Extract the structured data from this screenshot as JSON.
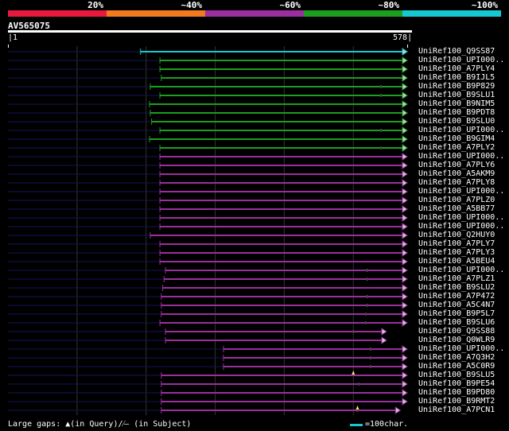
{
  "legend": {
    "segments": [
      {
        "label": "20%",
        "color": "#e8193c"
      },
      {
        "label": "~40%",
        "color": "#f07a1d"
      },
      {
        "label": "~60%",
        "color": "#9b2fa0"
      },
      {
        "label": "~80%",
        "color": "#1e9e1e"
      },
      {
        "label": "~100%",
        "color": "#17c7d2"
      }
    ]
  },
  "query": {
    "name": "AV565075",
    "start": "1",
    "end": "578",
    "length": 578
  },
  "hits": [
    {
      "name": "UniRef100_Q9SS87",
      "start": 192,
      "end": 578,
      "color": "#17c7d2",
      "gap": null
    },
    {
      "name": "UniRef100_UPI000..",
      "start": 220,
      "end": 578,
      "color": "#1e9e1e",
      "gap": null
    },
    {
      "name": "UniRef100_A7PLY4",
      "start": 220,
      "end": 578,
      "color": "#1e9e1e",
      "gap": null
    },
    {
      "name": "UniRef100_B9IJL5",
      "start": 222,
      "end": 578,
      "color": "#1e9e1e",
      "gap": null
    },
    {
      "name": "UniRef100_B9P829",
      "start": 206,
      "end": 578,
      "color": "#1e9e1e",
      "gap": 540
    },
    {
      "name": "UniRef100_B9SLU1",
      "start": 220,
      "end": 578,
      "color": "#1e9e1e",
      "gap": 540
    },
    {
      "name": "UniRef100_B9NIM5",
      "start": 205,
      "end": 578,
      "color": "#1e9e1e",
      "gap": null
    },
    {
      "name": "UniRef100_B9PDT8",
      "start": 206,
      "end": 578,
      "color": "#1e9e1e",
      "gap": null
    },
    {
      "name": "UniRef100_B9SLU0",
      "start": 208,
      "end": 578,
      "color": "#1e9e1e",
      "gap": null
    },
    {
      "name": "UniRef100_UPI000..",
      "start": 220,
      "end": 578,
      "color": "#1e9e1e",
      "gap": 540
    },
    {
      "name": "UniRef100_B9GIM4",
      "start": 205,
      "end": 578,
      "color": "#1e9e1e",
      "gap": null
    },
    {
      "name": "UniRef100_A7PLY2",
      "start": 220,
      "end": 578,
      "color": "#1e9e1e",
      "gap": 540
    },
    {
      "name": "UniRef100_UPI000..",
      "start": 220,
      "end": 578,
      "color": "#9b2fa0",
      "gap": null
    },
    {
      "name": "UniRef100_A7PLY6",
      "start": 220,
      "end": 578,
      "color": "#9b2fa0",
      "gap": null
    },
    {
      "name": "UniRef100_A5AKM9",
      "start": 220,
      "end": 578,
      "color": "#9b2fa0",
      "gap": null
    },
    {
      "name": "UniRef100_A7PLY8",
      "start": 220,
      "end": 578,
      "color": "#9b2fa0",
      "gap": null
    },
    {
      "name": "UniRef100_UPI000..",
      "start": 220,
      "end": 578,
      "color": "#9b2fa0",
      "gap": null
    },
    {
      "name": "UniRef100_A7PLZ0",
      "start": 220,
      "end": 578,
      "color": "#9b2fa0",
      "gap": null
    },
    {
      "name": "UniRef100_A5BB77",
      "start": 220,
      "end": 578,
      "color": "#9b2fa0",
      "gap": null
    },
    {
      "name": "UniRef100_UPI000..",
      "start": 220,
      "end": 578,
      "color": "#9b2fa0",
      "gap": null
    },
    {
      "name": "UniRef100_UPI000..",
      "start": 220,
      "end": 578,
      "color": "#9b2fa0",
      "gap": null
    },
    {
      "name": "UniRef100_Q2HUY0",
      "start": 206,
      "end": 578,
      "color": "#9b2fa0",
      "gap": null
    },
    {
      "name": "UniRef100_A7PLY7",
      "start": 220,
      "end": 578,
      "color": "#9b2fa0",
      "gap": null
    },
    {
      "name": "UniRef100_A7PLY3",
      "start": 220,
      "end": 578,
      "color": "#9b2fa0",
      "gap": null
    },
    {
      "name": "UniRef100_A5BEU4",
      "start": 220,
      "end": 578,
      "color": "#9b2fa0",
      "gap": null
    },
    {
      "name": "UniRef100_UPI000..",
      "start": 228,
      "end": 578,
      "color": "#9b2fa0",
      "gap": 520
    },
    {
      "name": "UniRef100_A7PLZ1",
      "start": 226,
      "end": 578,
      "color": "#9b2fa0",
      "gap": 520
    },
    {
      "name": "UniRef100_B9SLU2",
      "start": 224,
      "end": 578,
      "color": "#9b2fa0",
      "gap": null
    },
    {
      "name": "UniRef100_A7P472",
      "start": 222,
      "end": 578,
      "color": "#9b2fa0",
      "gap": 520
    },
    {
      "name": "UniRef100_A5C4N7",
      "start": 222,
      "end": 578,
      "color": "#9b2fa0",
      "gap": 520
    },
    {
      "name": "UniRef100_B9P5L7",
      "start": 222,
      "end": 578,
      "color": "#9b2fa0",
      "gap": 518
    },
    {
      "name": "UniRef100_B9SLU6",
      "start": 220,
      "end": 578,
      "color": "#9b2fa0",
      "gap": 518
    },
    {
      "name": "UniRef100_Q9SS88",
      "start": 228,
      "end": 548,
      "color": "#9b2fa0",
      "gap": 500
    },
    {
      "name": "UniRef100_Q0WLR9",
      "start": 228,
      "end": 548,
      "color": "#9b2fa0",
      "gap": null
    },
    {
      "name": "UniRef100_UPI000..",
      "start": 312,
      "end": 578,
      "color": "#9b2fa0",
      "gap": 525
    },
    {
      "name": "UniRef100_A7Q3H2",
      "start": 312,
      "end": 578,
      "color": "#9b2fa0",
      "gap": 525
    },
    {
      "name": "UniRef100_A5C0R9",
      "start": 312,
      "end": 578,
      "color": "#9b2fa0",
      "gap": 525
    },
    {
      "name": "UniRef100_B9SLU5",
      "start": 222,
      "end": 578,
      "color": "#9b2fa0",
      "gap": null
    },
    {
      "name": "UniRef100_B9PE54",
      "start": 222,
      "end": 578,
      "color": "#9b2fa0",
      "gap": 508
    },
    {
      "name": "UniRef100_B9PD80",
      "start": 222,
      "end": 578,
      "color": "#9b2fa0",
      "gap": null
    },
    {
      "name": "UniRef100_B9RMT2",
      "start": 222,
      "end": 578,
      "color": "#9b2fa0",
      "gap": null
    },
    {
      "name": "UniRef100_A7PCN1",
      "start": 222,
      "end": 568,
      "color": "#9b2fa0",
      "gap": 506
    }
  ],
  "query_gap_hits": [
    37,
    41
  ],
  "footer": {
    "left": "Large gaps: ▲(in Query)/⁄– (in Subject)",
    "right": "=100char."
  }
}
